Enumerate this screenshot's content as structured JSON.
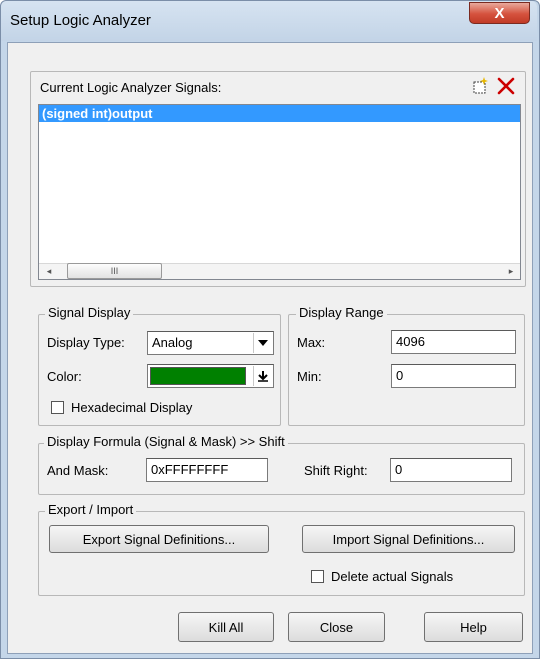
{
  "window": {
    "title": "Setup Logic Analyzer",
    "close_glyph": "X"
  },
  "signals": {
    "header": "Current Logic Analyzer Signals:",
    "items": [
      "(signed int)output"
    ],
    "scroll_thumb_glyph": "III",
    "scroll_left_glyph": "◂",
    "scroll_right_glyph": "▸"
  },
  "signal_display": {
    "legend": "Signal Display",
    "display_type_label": "Display Type:",
    "display_type_value": "Analog",
    "color_label": "Color:",
    "color_value": "#008000",
    "hex_label": "Hexadecimal Display",
    "hex_checked": false
  },
  "display_range": {
    "legend": "Display Range",
    "max_label": "Max:",
    "max_value": "4096",
    "min_label": "Min:",
    "min_value": "0"
  },
  "formula": {
    "legend": "Display Formula (Signal & Mask) >> Shift",
    "and_mask_label": "And Mask:",
    "and_mask_value": "0xFFFFFFFF",
    "shift_label": "Shift Right:",
    "shift_value": "0"
  },
  "export_import": {
    "legend": "Export / Import",
    "export_label": "Export Signal Definitions...",
    "import_label": "Import Signal Definitions...",
    "delete_label": "Delete actual Signals",
    "delete_checked": false
  },
  "footer": {
    "kill_all": "Kill All",
    "close": "Close",
    "help": "Help"
  },
  "colors": {
    "selection": "#3399ff",
    "delete_icon": "#cc0000"
  }
}
